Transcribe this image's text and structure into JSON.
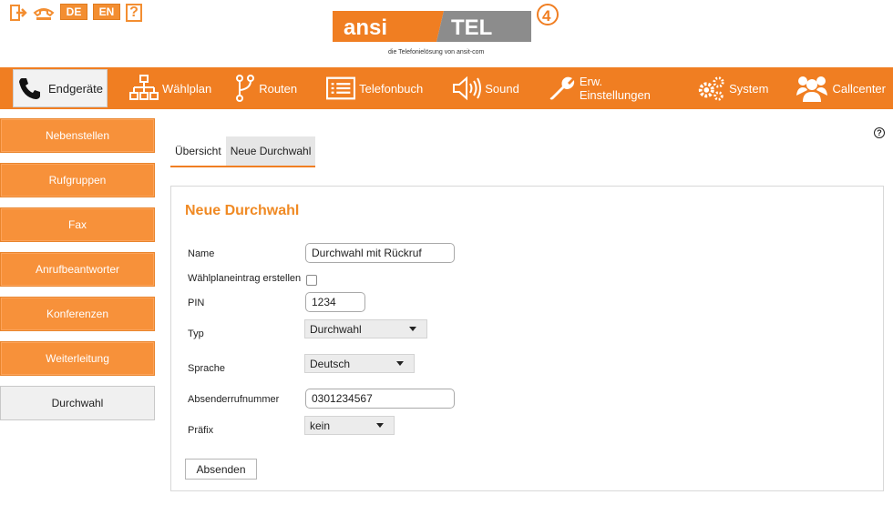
{
  "topbar": {
    "lang_de": "DE",
    "lang_en": "EN",
    "help": "?",
    "icons": [
      "logout-icon",
      "phone-hangup-icon"
    ]
  },
  "logo": {
    "left": "ansi",
    "right": "TEL",
    "version": "4",
    "tagline": "die Telefonielösung von ansit-com"
  },
  "mainnav": [
    {
      "label": "Endgeräte",
      "icon": "phone-icon"
    },
    {
      "label": "Wählplan",
      "icon": "sitemap-icon"
    },
    {
      "label": "Routen",
      "icon": "route-icon"
    },
    {
      "label": "Telefonbuch",
      "icon": "list-icon"
    },
    {
      "label": "Sound",
      "icon": "speaker-icon"
    },
    {
      "label": "Erw. Einstellungen",
      "icon": "wrench-icon"
    },
    {
      "label": "System",
      "icon": "gears-icon"
    },
    {
      "label": "Callcenter",
      "icon": "users-icon"
    }
  ],
  "sidebar": [
    "Nebenstellen",
    "Rufgruppen",
    "Fax",
    "Anrufbeantworter",
    "Konferenzen",
    "Weiterleitung",
    "Durchwahl"
  ],
  "tabs": [
    "Übersicht",
    "Neue Durchwahl"
  ],
  "form": {
    "title": "Neue Durchwahl",
    "name_label": "Name",
    "name_value": "Durchwahl mit Rückruf",
    "dialplan_label": "Wählplaneintrag erstellen",
    "pin_label": "PIN",
    "pin_value": "1234",
    "typ_label": "Typ",
    "typ_value": "Durchwahl",
    "sprache_label": "Sprache",
    "sprache_value": "Deutsch",
    "absender_label": "Absenderrufnummer",
    "absender_value": "0301234567",
    "praefix_label": "Präfix",
    "praefix_value": "kein",
    "submit": "Absenden"
  },
  "colors": {
    "accent": "#f07e22",
    "title": "#f08a24"
  }
}
